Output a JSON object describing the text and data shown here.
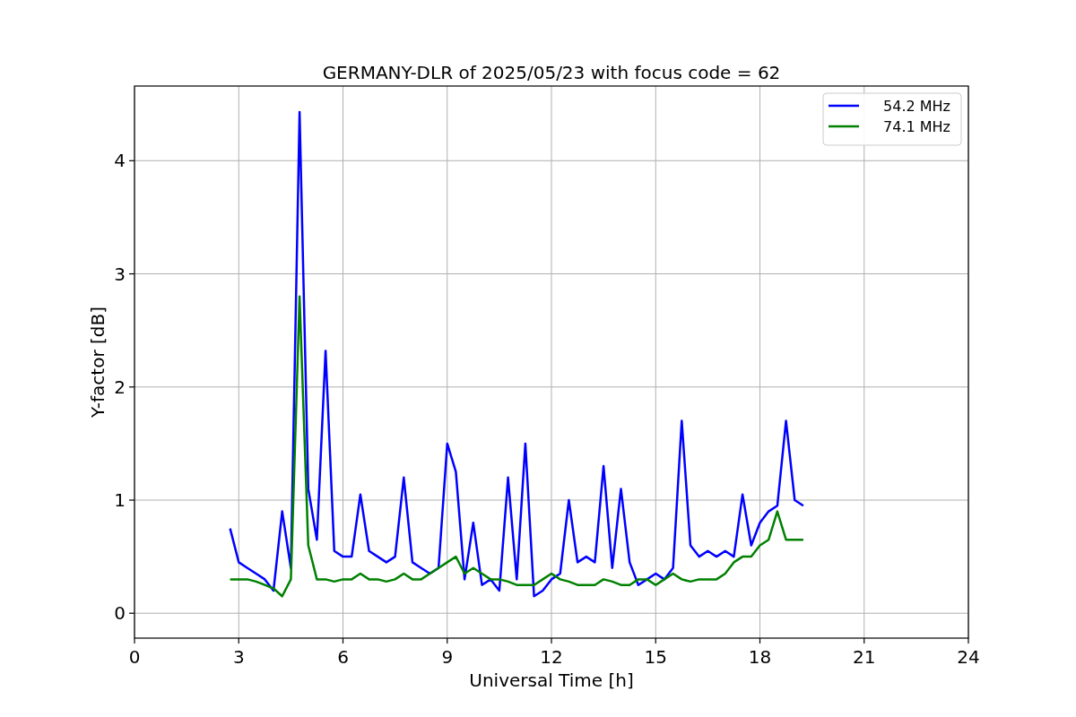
{
  "chart": {
    "chart_data": {
      "type": "line",
      "title": "GERMANY-DLR of 2025/05/23 with focus code = 62",
      "xlabel": "Universal Time [h]",
      "ylabel": "Y-factor [dB]",
      "x": [
        2.75,
        3,
        3.25,
        3.5,
        3.75,
        4,
        4.25,
        4.5,
        4.75,
        5,
        5.25,
        5.5,
        5.75,
        6,
        6.25,
        6.5,
        6.75,
        7,
        7.25,
        7.5,
        7.75,
        8,
        8.25,
        8.5,
        8.75,
        9,
        9.25,
        9.5,
        9.75,
        10,
        10.25,
        10.5,
        10.75,
        11,
        11.25,
        11.5,
        11.75,
        12,
        12.25,
        12.5,
        12.75,
        13,
        13.25,
        13.5,
        13.75,
        14,
        14.25,
        14.5,
        14.75,
        15,
        15.25,
        15.5,
        15.75,
        16,
        16.25,
        16.5,
        16.75,
        17,
        17.25,
        17.5,
        17.75,
        18,
        18.25,
        18.5,
        18.75,
        19,
        19.25
      ],
      "series": [
        {
          "name": "54.2 MHz",
          "color": "#0000ff",
          "values": [
            0.75,
            0.45,
            0.4,
            0.35,
            0.3,
            0.2,
            0.9,
            0.4,
            4.43,
            1.1,
            0.65,
            2.32,
            0.55,
            0.5,
            0.5,
            1.05,
            0.55,
            0.5,
            0.45,
            0.5,
            1.2,
            0.45,
            0.4,
            0.35,
            0.4,
            1.5,
            1.25,
            0.3,
            0.8,
            0.25,
            0.3,
            0.2,
            1.2,
            0.3,
            1.5,
            0.15,
            0.2,
            0.3,
            0.35,
            1.0,
            0.45,
            0.5,
            0.45,
            1.3,
            0.4,
            1.1,
            0.45,
            0.25,
            0.3,
            0.35,
            0.3,
            0.4,
            1.7,
            0.6,
            0.5,
            0.55,
            0.5,
            0.55,
            0.5,
            1.05,
            0.6,
            0.8,
            0.9,
            0.95,
            1.7,
            1.0,
            0.95
          ]
        },
        {
          "name": "74.1 MHz",
          "color": "#008000",
          "values": [
            0.3,
            0.3,
            0.3,
            0.28,
            0.25,
            0.22,
            0.15,
            0.3,
            2.8,
            0.6,
            0.3,
            0.3,
            0.28,
            0.3,
            0.3,
            0.35,
            0.3,
            0.3,
            0.28,
            0.3,
            0.35,
            0.3,
            0.3,
            0.35,
            0.4,
            0.45,
            0.5,
            0.35,
            0.4,
            0.35,
            0.3,
            0.3,
            0.28,
            0.25,
            0.25,
            0.25,
            0.3,
            0.35,
            0.3,
            0.28,
            0.25,
            0.25,
            0.25,
            0.3,
            0.28,
            0.25,
            0.25,
            0.3,
            0.3,
            0.25,
            0.3,
            0.35,
            0.3,
            0.28,
            0.3,
            0.3,
            0.3,
            0.35,
            0.45,
            0.5,
            0.5,
            0.6,
            0.65,
            0.9,
            0.65,
            0.65,
            0.65
          ]
        }
      ],
      "grid": true,
      "legend": true,
      "xlim": [
        0,
        24
      ],
      "ylim": [
        -0.22,
        4.66
      ],
      "xticks": [
        0,
        3,
        6,
        9,
        12,
        15,
        18,
        21,
        24
      ],
      "yticks": [
        0,
        1,
        2,
        3,
        4
      ]
    }
  }
}
